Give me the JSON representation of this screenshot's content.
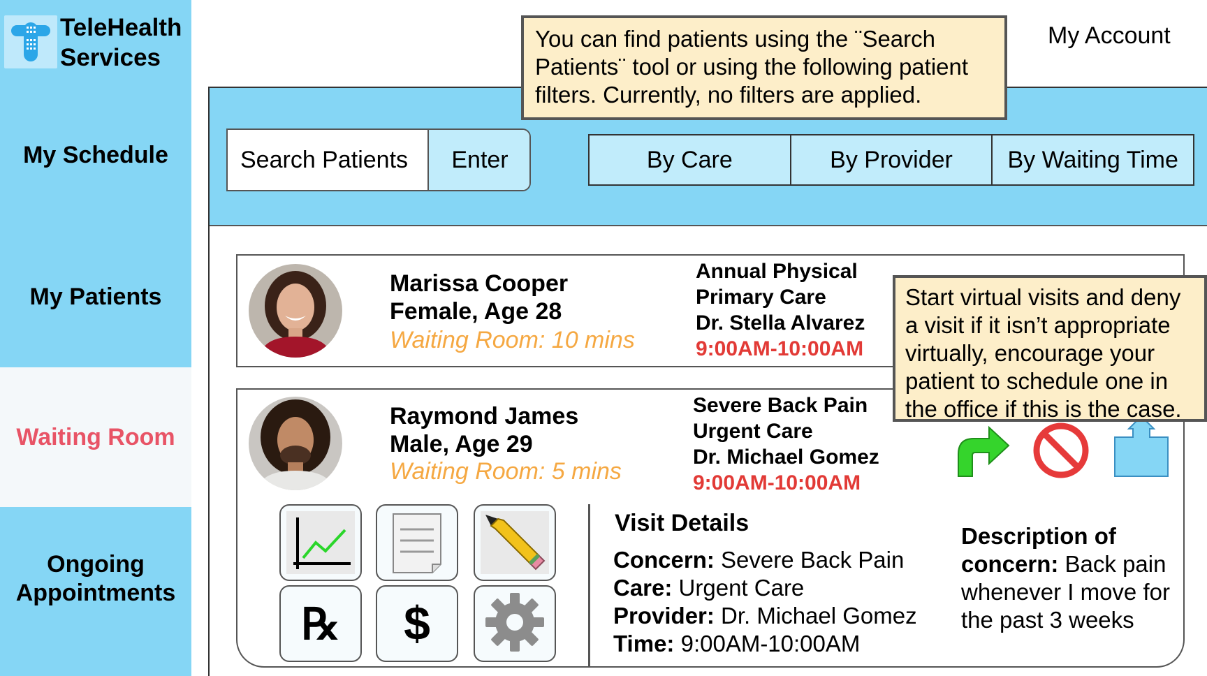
{
  "brand": {
    "line1": "TeleHealth",
    "line2": "Services"
  },
  "sidebar": {
    "items": [
      {
        "label": "My Schedule"
      },
      {
        "label": "My Patients"
      },
      {
        "label": "Waiting Room",
        "active": true
      },
      {
        "label_line1": "Ongoing",
        "label_line2": "Appointments"
      }
    ]
  },
  "header": {
    "account_label": "My Account"
  },
  "search": {
    "placeholder": "Search Patients",
    "enter_label": "Enter"
  },
  "filters": [
    "By Care",
    "By Provider",
    "By Waiting Time"
  ],
  "tooltips": {
    "search_help": "You can find patients using the ¨Search Patients¨ tool or using the following patient filters. Currently, no filters are applied.",
    "visit_help": "Start virtual visits and deny a visit if it isn’t appropriate virtually, encourage your patient to schedule one in the office if this is the case."
  },
  "patients": [
    {
      "name": "Marissa Cooper",
      "gender_age": "Female, Age 28",
      "waiting": "Waiting Room: 10 mins",
      "visit_type": "Annual Physical",
      "care": "Primary Care",
      "provider": "Dr. Stella Alvarez",
      "time": "9:00AM-10:00AM"
    },
    {
      "name": "Raymond James",
      "gender_age": "Male, Age 29",
      "waiting": "Waiting Room: 5 mins",
      "visit_type": "Severe Back Pain",
      "care": "Urgent Care",
      "provider": "Dr. Michael Gomez",
      "time": "9:00AM-10:00AM"
    }
  ],
  "visit_details": {
    "title": "Visit Details",
    "concern_label": "Concern:",
    "concern": " Severe Back Pain",
    "care_label": "Care:",
    "care": " Urgent Care",
    "provider_label": "Provider:",
    "provider": " Dr. Michael Gomez",
    "time_label": "Time:",
    "time": " 9:00AM-10:00AM",
    "description_label": "Description of concern:",
    "description": " Back pain whenever I move for the past 3 weeks"
  },
  "tools": {
    "rx_glyph": "℞",
    "billing_glyph": "$"
  },
  "icons": [
    "chart-icon",
    "notes-icon",
    "pencil-icon",
    "prescription-icon",
    "billing-icon",
    "gear-icon",
    "start-visit-arrow-icon",
    "deny-visit-icon",
    "export-icon"
  ],
  "colors": {
    "sidebar": "#85d6f5",
    "active_nav_text": "#e85466",
    "waiting_text": "#f5a842",
    "time_text": "#e23a36",
    "tooltip_bg": "#fdeec9"
  }
}
